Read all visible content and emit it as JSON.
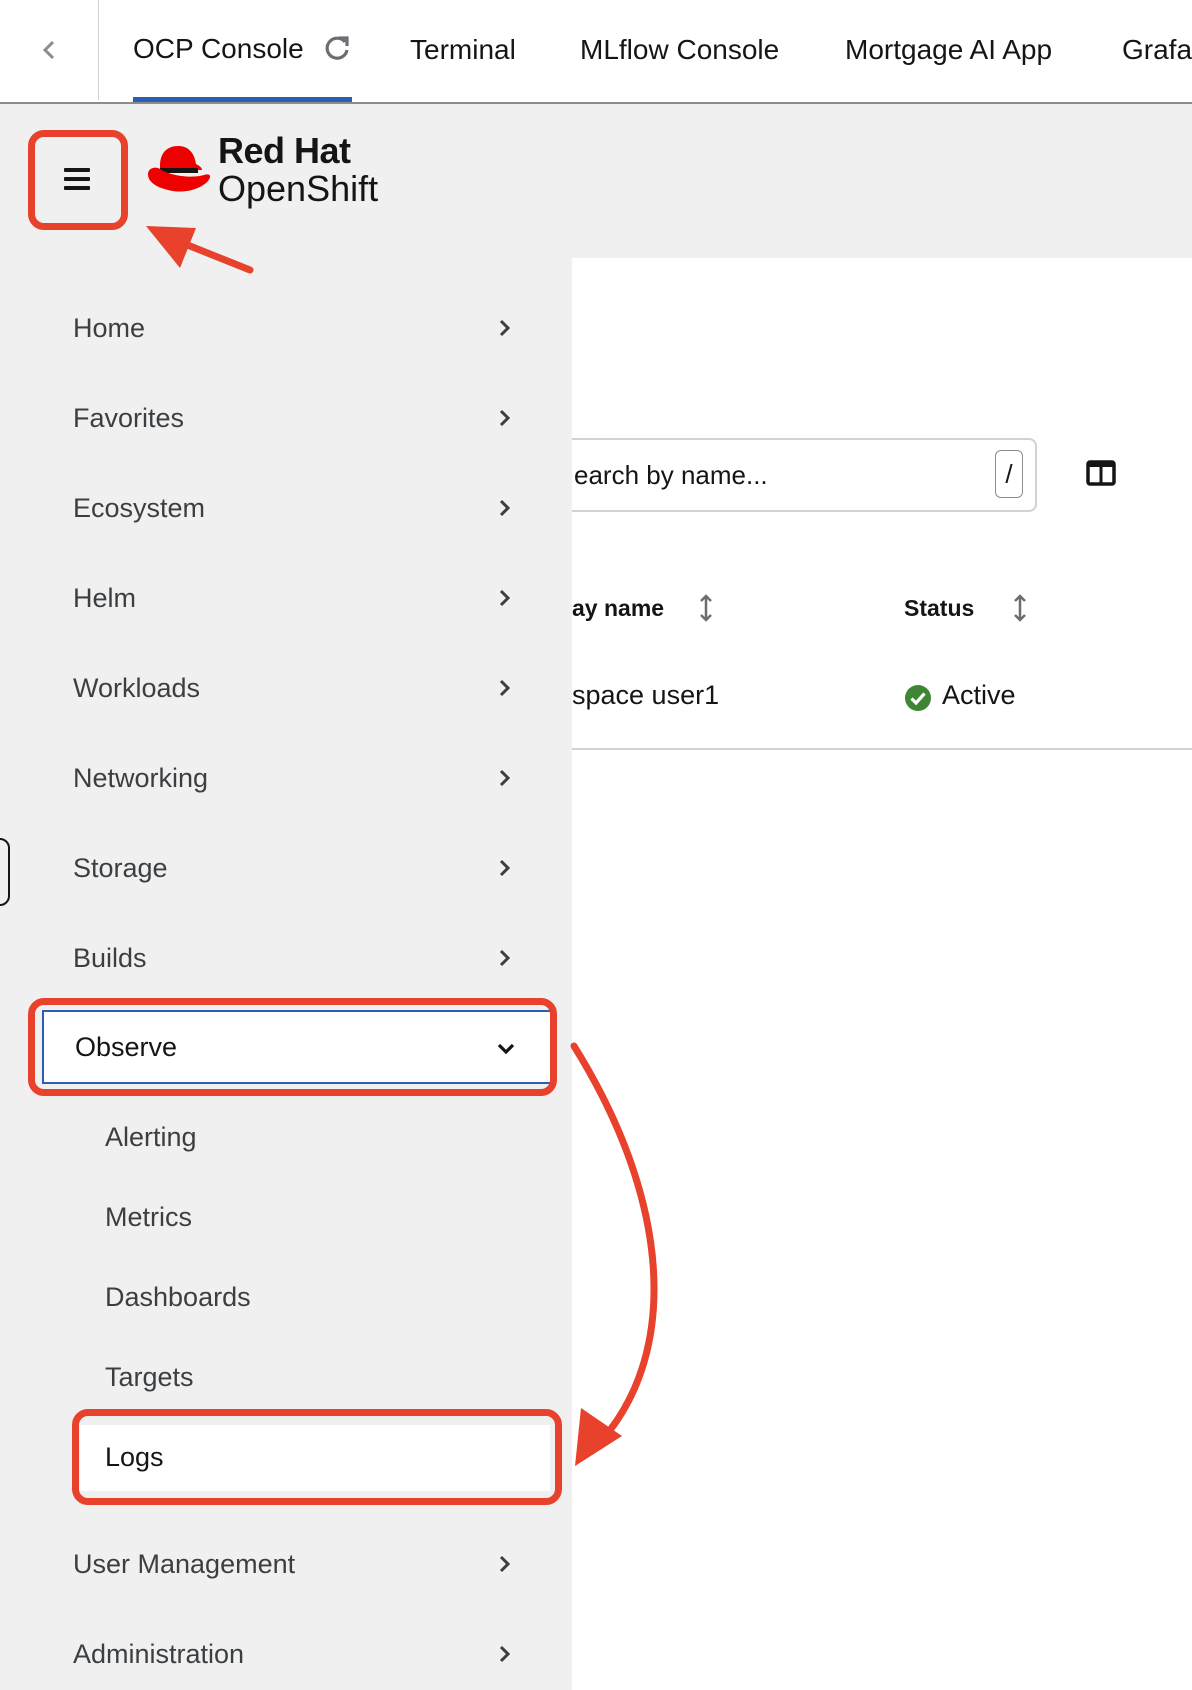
{
  "colors": {
    "accent_blue": "#2b5fb4",
    "annotation_red": "#e8412c",
    "nav_bg": "#f0f0f0",
    "status_green": "#3e8635",
    "redhat_red": "#ee0000"
  },
  "tabs": [
    {
      "label": "OCP Console",
      "active": true,
      "icon": "reload-icon"
    },
    {
      "label": "Terminal",
      "active": false
    },
    {
      "label": "MLflow Console",
      "active": false
    },
    {
      "label": "Mortgage AI App",
      "active": false
    },
    {
      "label": "Grafa",
      "active": false
    }
  ],
  "masthead": {
    "logo_line1": "Red Hat",
    "logo_line2": "OpenShift",
    "menu_icon": "hamburger-icon"
  },
  "toolbar": {
    "search_placeholder": "earch by name...",
    "search_shortcut": "/",
    "column_icon": "columns-icon"
  },
  "table": {
    "headers": [
      {
        "label": "ay name",
        "sortable": true
      },
      {
        "label": "Status",
        "sortable": true
      }
    ],
    "rows": [
      {
        "name": "space user1",
        "status": "Active"
      }
    ]
  },
  "nav": {
    "items": [
      {
        "label": "Home"
      },
      {
        "label": "Favorites"
      },
      {
        "label": "Ecosystem"
      },
      {
        "label": "Helm"
      },
      {
        "label": "Workloads"
      },
      {
        "label": "Networking"
      },
      {
        "label": "Storage"
      },
      {
        "label": "Builds"
      },
      {
        "label": "Observe",
        "expanded": true
      },
      {
        "label": "User Management"
      },
      {
        "label": "Administration"
      }
    ],
    "observe_children": [
      {
        "label": "Alerting"
      },
      {
        "label": "Metrics"
      },
      {
        "label": "Dashboards"
      },
      {
        "label": "Targets"
      },
      {
        "label": "Logs",
        "current": true
      }
    ]
  }
}
